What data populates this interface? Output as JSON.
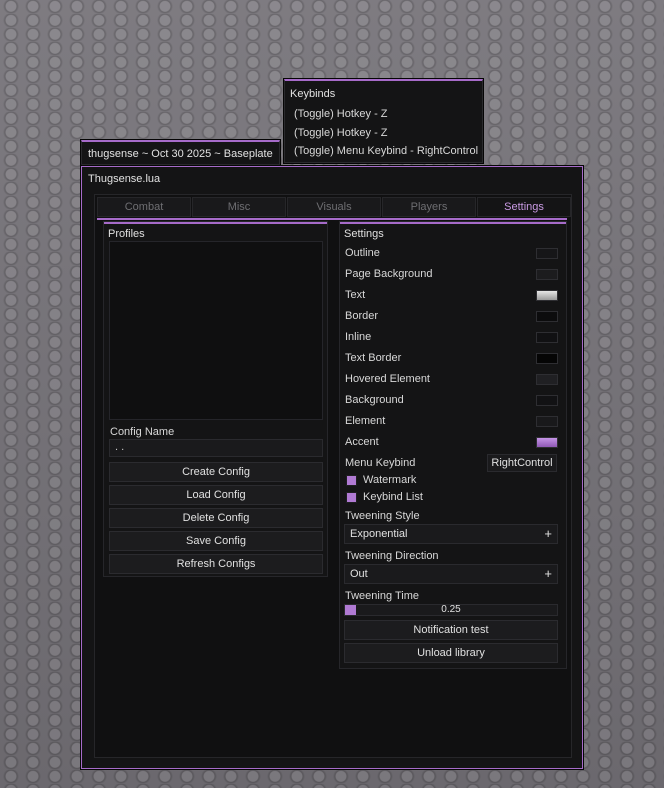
{
  "watermark": {
    "text": "thugsense ~ Oct 30 2025 ~ Baseplate"
  },
  "keybinds": {
    "title": "Keybinds",
    "items": [
      "(Toggle) Hotkey - Z",
      "(Toggle) Hotkey - Z",
      "(Toggle) Menu Keybind - RightControl"
    ]
  },
  "window": {
    "title": "Thugsense.lua",
    "tabs": [
      "Combat",
      "Misc",
      "Visuals",
      "Players",
      "Settings"
    ],
    "active_tab": "Settings"
  },
  "profiles": {
    "title": "Profiles",
    "config_name_label": "Config Name",
    "config_name_value": ". .",
    "buttons": [
      "Create Config",
      "Load Config",
      "Delete Config",
      "Save Config",
      "Refresh Configs"
    ]
  },
  "settings": {
    "title": "Settings",
    "colors": [
      {
        "label": "Outline",
        "color": "#161618"
      },
      {
        "label": "Page Background",
        "color": "#1c1c1e"
      },
      {
        "label": "Text",
        "color": "#d2d2d2"
      },
      {
        "label": "Border",
        "color": "#0c0c0d"
      },
      {
        "label": "Inline",
        "color": "#111113"
      },
      {
        "label": "Text Border",
        "color": "#050505"
      },
      {
        "label": "Hovered Element",
        "color": "#202023"
      },
      {
        "label": "Background",
        "color": "#121214"
      },
      {
        "label": "Element",
        "color": "#19191b"
      },
      {
        "label": "Accent",
        "color": "#b07ad3"
      }
    ],
    "menu_keybind_label": "Menu Keybind",
    "menu_keybind_value": "RightControl",
    "checkboxes": [
      {
        "label": "Watermark",
        "checked": true
      },
      {
        "label": "Keybind List",
        "checked": true
      }
    ],
    "tween_style_label": "Tweening Style",
    "tween_style_value": "Exponential",
    "tween_dir_label": "Tweening Direction",
    "tween_dir_value": "Out",
    "tween_time_label": "Tweening Time",
    "tween_time_value": "0.25",
    "tween_time_fraction": 0.05,
    "buttons": [
      "Notification test",
      "Unload library"
    ]
  }
}
